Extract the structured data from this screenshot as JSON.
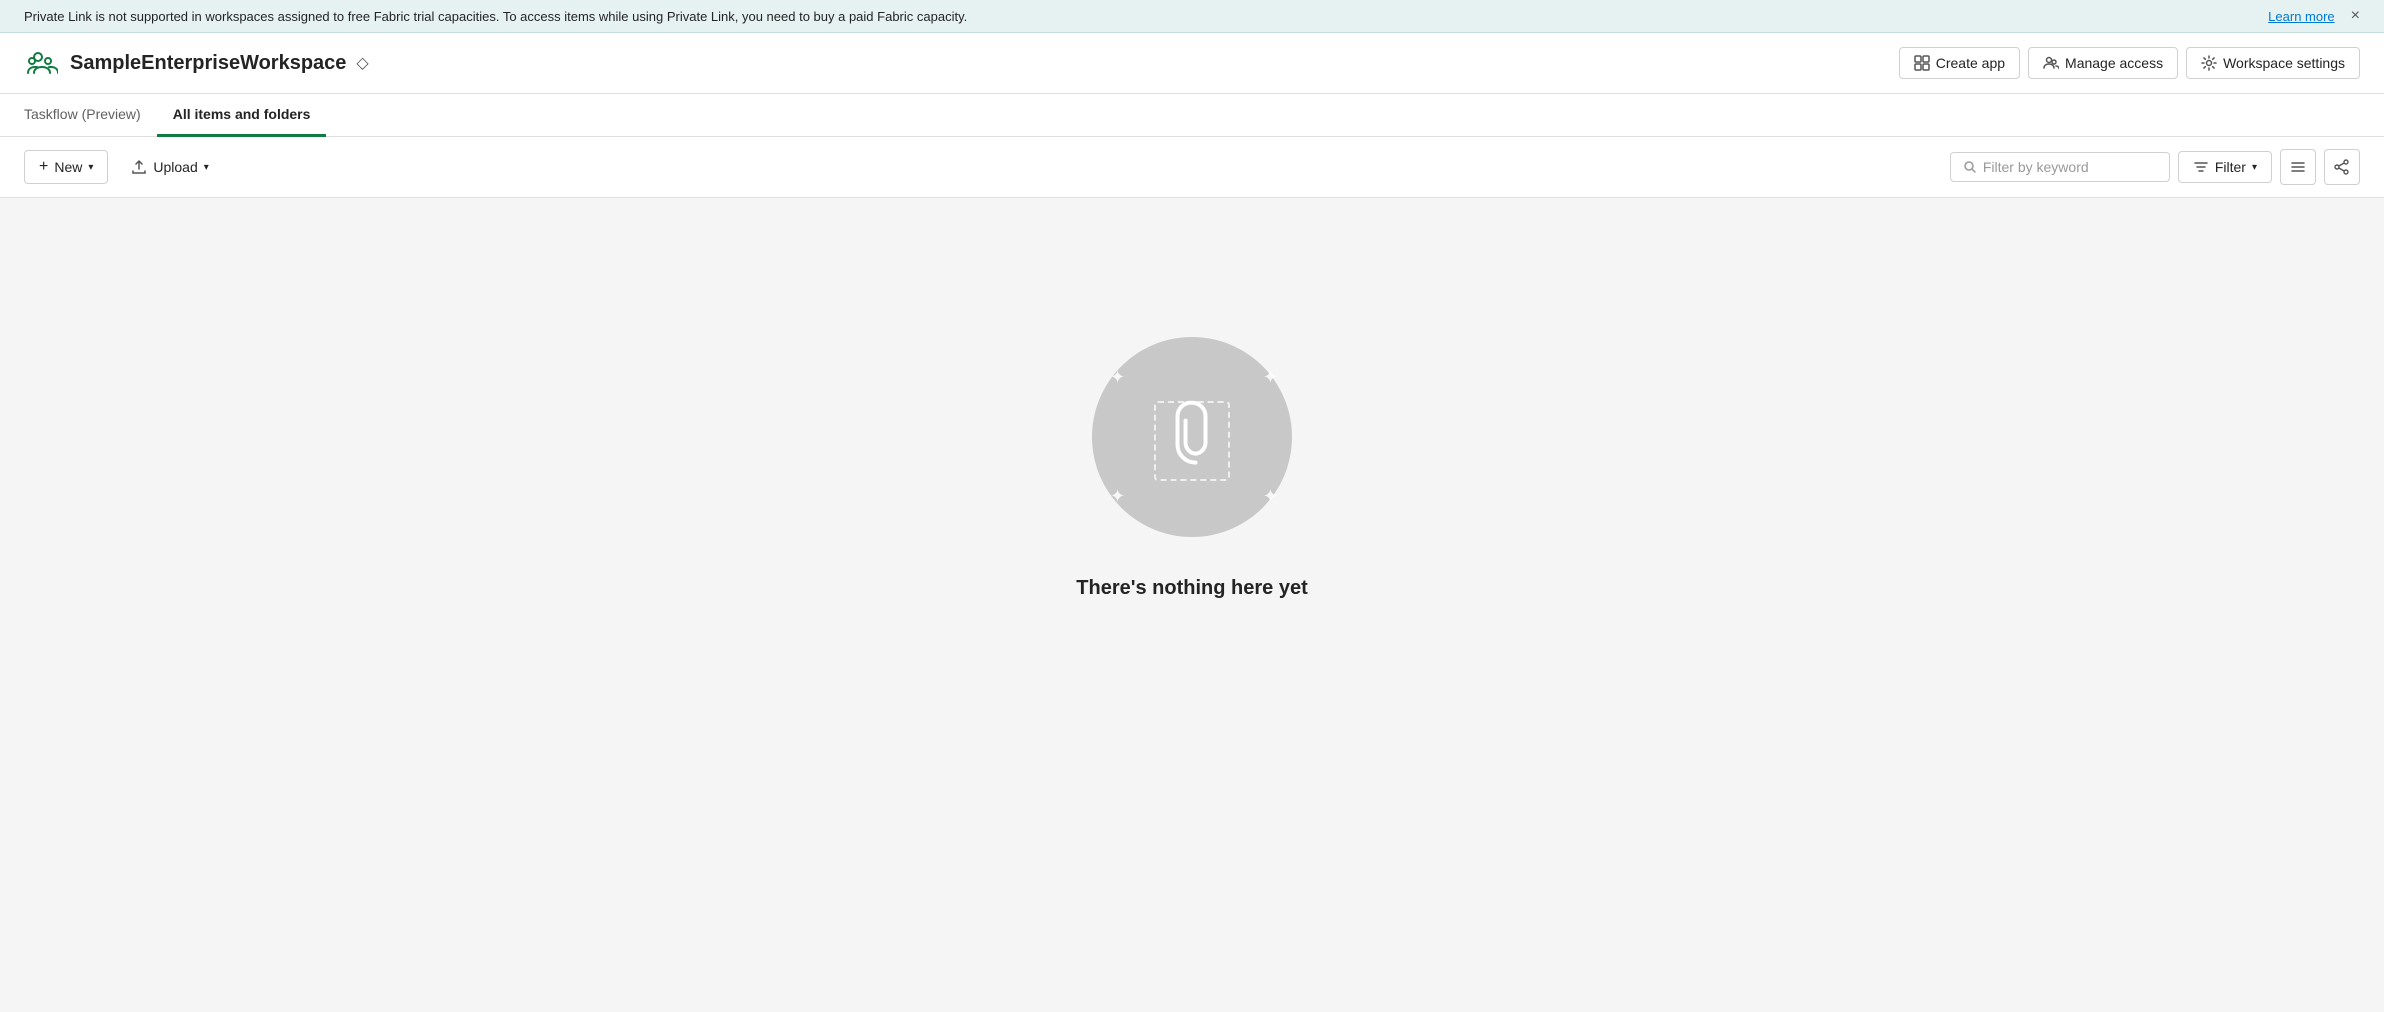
{
  "banner": {
    "message": "Private Link is not supported in workspaces assigned to free Fabric trial capacities. To access items while using Private Link, you need to buy a paid Fabric capacity.",
    "learn_more_label": "Learn more",
    "close_label": "×"
  },
  "header": {
    "workspace_name": "SampleEnterpriseWorkspace",
    "create_app_label": "Create app",
    "manage_access_label": "Manage access",
    "workspace_settings_label": "Workspace settings"
  },
  "tabs": [
    {
      "id": "taskflow",
      "label": "Taskflow (Preview)",
      "active": false
    },
    {
      "id": "all-items",
      "label": "All items and folders",
      "active": true
    }
  ],
  "toolbar": {
    "new_label": "New",
    "upload_label": "Upload",
    "filter_placeholder": "Filter by keyword",
    "filter_label": "Filter"
  },
  "main": {
    "empty_title": "There's nothing here yet"
  }
}
